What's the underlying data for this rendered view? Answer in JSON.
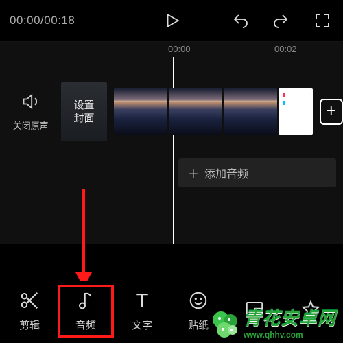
{
  "timecode": {
    "current": "00:00",
    "total": "00:18"
  },
  "ruler": {
    "t0": "00:00",
    "t1": "00:02"
  },
  "mute": {
    "label": "关闭原声"
  },
  "cover": {
    "label": "设置\n封面"
  },
  "add_audio": {
    "plus": "＋",
    "label": "添加音频"
  },
  "add_clip": {
    "plus": "+"
  },
  "toolbar": {
    "cut": {
      "label": "剪辑"
    },
    "audio": {
      "label": "音频"
    },
    "text": {
      "label": "文字"
    },
    "sticker": {
      "label": "贴纸"
    }
  },
  "watermark": {
    "brand": "青花安卓网",
    "url": "www.qhhv.com"
  }
}
